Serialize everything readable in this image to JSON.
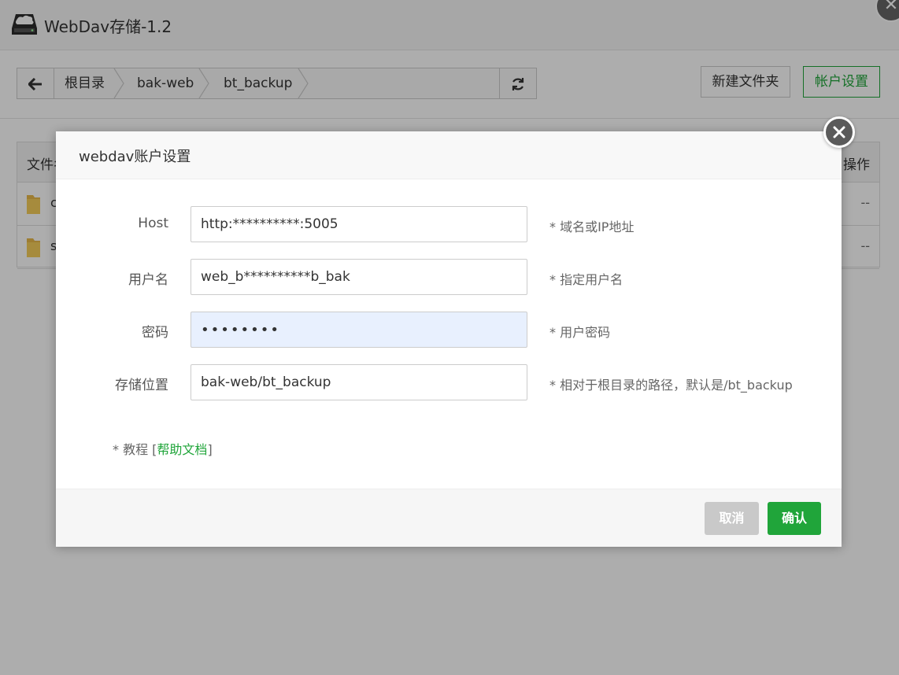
{
  "app": {
    "title": "WebDav存储-1.2",
    "logo_icon": "cloud-drive-icon",
    "close_icon": "close-icon"
  },
  "breadcrumb": {
    "back_icon": "arrow-left-icon",
    "items": [
      "根目录",
      "bak-web",
      "bt_backup"
    ],
    "refresh_icon": "refresh-icon"
  },
  "toolbar": {
    "new_folder_label": "新建文件夹",
    "account_settings_label": "帐户设置"
  },
  "table": {
    "col_name": "文件名",
    "col_ops": "操作",
    "rows": [
      {
        "name": "c",
        "ops": "--"
      },
      {
        "name": "s",
        "ops": "--"
      }
    ]
  },
  "modal": {
    "title": "webdav账户设置",
    "fields": [
      {
        "label": "Host",
        "value": "http:**********:5005",
        "hint": "* 域名或IP地址"
      },
      {
        "label": "用户名",
        "value": "web_b**********b_bak",
        "hint": "* 指定用户名"
      },
      {
        "label": "密码",
        "value": "••••••••",
        "hint": "* 用户密码"
      },
      {
        "label": "存储位置",
        "value": "bak-web/bt_backup",
        "hint": "* 相对于根目录的路径，默认是/bt_backup"
      }
    ],
    "tutorial_prefix": "* 教程 [",
    "tutorial_link": "帮助文档",
    "tutorial_suffix": "]",
    "cancel_label": "取消",
    "confirm_label": "确认"
  },
  "colors": {
    "accent": "#20a53a",
    "overlay": "rgba(0,0,0,0.32)",
    "autofill": "#e8f0fe"
  }
}
